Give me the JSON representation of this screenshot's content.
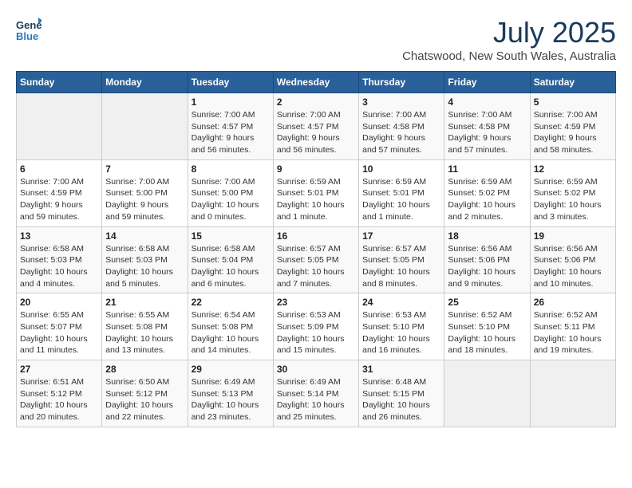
{
  "header": {
    "logo_line1": "General",
    "logo_line2": "Blue",
    "month": "July 2025",
    "location": "Chatswood, New South Wales, Australia"
  },
  "weekdays": [
    "Sunday",
    "Monday",
    "Tuesday",
    "Wednesday",
    "Thursday",
    "Friday",
    "Saturday"
  ],
  "weeks": [
    [
      {
        "day": "",
        "info": ""
      },
      {
        "day": "",
        "info": ""
      },
      {
        "day": "1",
        "info": "Sunrise: 7:00 AM\nSunset: 4:57 PM\nDaylight: 9 hours\nand 56 minutes."
      },
      {
        "day": "2",
        "info": "Sunrise: 7:00 AM\nSunset: 4:57 PM\nDaylight: 9 hours\nand 56 minutes."
      },
      {
        "day": "3",
        "info": "Sunrise: 7:00 AM\nSunset: 4:58 PM\nDaylight: 9 hours\nand 57 minutes."
      },
      {
        "day": "4",
        "info": "Sunrise: 7:00 AM\nSunset: 4:58 PM\nDaylight: 9 hours\nand 57 minutes."
      },
      {
        "day": "5",
        "info": "Sunrise: 7:00 AM\nSunset: 4:59 PM\nDaylight: 9 hours\nand 58 minutes."
      }
    ],
    [
      {
        "day": "6",
        "info": "Sunrise: 7:00 AM\nSunset: 4:59 PM\nDaylight: 9 hours\nand 59 minutes."
      },
      {
        "day": "7",
        "info": "Sunrise: 7:00 AM\nSunset: 5:00 PM\nDaylight: 9 hours\nand 59 minutes."
      },
      {
        "day": "8",
        "info": "Sunrise: 7:00 AM\nSunset: 5:00 PM\nDaylight: 10 hours\nand 0 minutes."
      },
      {
        "day": "9",
        "info": "Sunrise: 6:59 AM\nSunset: 5:01 PM\nDaylight: 10 hours\nand 1 minute."
      },
      {
        "day": "10",
        "info": "Sunrise: 6:59 AM\nSunset: 5:01 PM\nDaylight: 10 hours\nand 1 minute."
      },
      {
        "day": "11",
        "info": "Sunrise: 6:59 AM\nSunset: 5:02 PM\nDaylight: 10 hours\nand 2 minutes."
      },
      {
        "day": "12",
        "info": "Sunrise: 6:59 AM\nSunset: 5:02 PM\nDaylight: 10 hours\nand 3 minutes."
      }
    ],
    [
      {
        "day": "13",
        "info": "Sunrise: 6:58 AM\nSunset: 5:03 PM\nDaylight: 10 hours\nand 4 minutes."
      },
      {
        "day": "14",
        "info": "Sunrise: 6:58 AM\nSunset: 5:03 PM\nDaylight: 10 hours\nand 5 minutes."
      },
      {
        "day": "15",
        "info": "Sunrise: 6:58 AM\nSunset: 5:04 PM\nDaylight: 10 hours\nand 6 minutes."
      },
      {
        "day": "16",
        "info": "Sunrise: 6:57 AM\nSunset: 5:05 PM\nDaylight: 10 hours\nand 7 minutes."
      },
      {
        "day": "17",
        "info": "Sunrise: 6:57 AM\nSunset: 5:05 PM\nDaylight: 10 hours\nand 8 minutes."
      },
      {
        "day": "18",
        "info": "Sunrise: 6:56 AM\nSunset: 5:06 PM\nDaylight: 10 hours\nand 9 minutes."
      },
      {
        "day": "19",
        "info": "Sunrise: 6:56 AM\nSunset: 5:06 PM\nDaylight: 10 hours\nand 10 minutes."
      }
    ],
    [
      {
        "day": "20",
        "info": "Sunrise: 6:55 AM\nSunset: 5:07 PM\nDaylight: 10 hours\nand 11 minutes."
      },
      {
        "day": "21",
        "info": "Sunrise: 6:55 AM\nSunset: 5:08 PM\nDaylight: 10 hours\nand 13 minutes."
      },
      {
        "day": "22",
        "info": "Sunrise: 6:54 AM\nSunset: 5:08 PM\nDaylight: 10 hours\nand 14 minutes."
      },
      {
        "day": "23",
        "info": "Sunrise: 6:53 AM\nSunset: 5:09 PM\nDaylight: 10 hours\nand 15 minutes."
      },
      {
        "day": "24",
        "info": "Sunrise: 6:53 AM\nSunset: 5:10 PM\nDaylight: 10 hours\nand 16 minutes."
      },
      {
        "day": "25",
        "info": "Sunrise: 6:52 AM\nSunset: 5:10 PM\nDaylight: 10 hours\nand 18 minutes."
      },
      {
        "day": "26",
        "info": "Sunrise: 6:52 AM\nSunset: 5:11 PM\nDaylight: 10 hours\nand 19 minutes."
      }
    ],
    [
      {
        "day": "27",
        "info": "Sunrise: 6:51 AM\nSunset: 5:12 PM\nDaylight: 10 hours\nand 20 minutes."
      },
      {
        "day": "28",
        "info": "Sunrise: 6:50 AM\nSunset: 5:12 PM\nDaylight: 10 hours\nand 22 minutes."
      },
      {
        "day": "29",
        "info": "Sunrise: 6:49 AM\nSunset: 5:13 PM\nDaylight: 10 hours\nand 23 minutes."
      },
      {
        "day": "30",
        "info": "Sunrise: 6:49 AM\nSunset: 5:14 PM\nDaylight: 10 hours\nand 25 minutes."
      },
      {
        "day": "31",
        "info": "Sunrise: 6:48 AM\nSunset: 5:15 PM\nDaylight: 10 hours\nand 26 minutes."
      },
      {
        "day": "",
        "info": ""
      },
      {
        "day": "",
        "info": ""
      }
    ]
  ]
}
